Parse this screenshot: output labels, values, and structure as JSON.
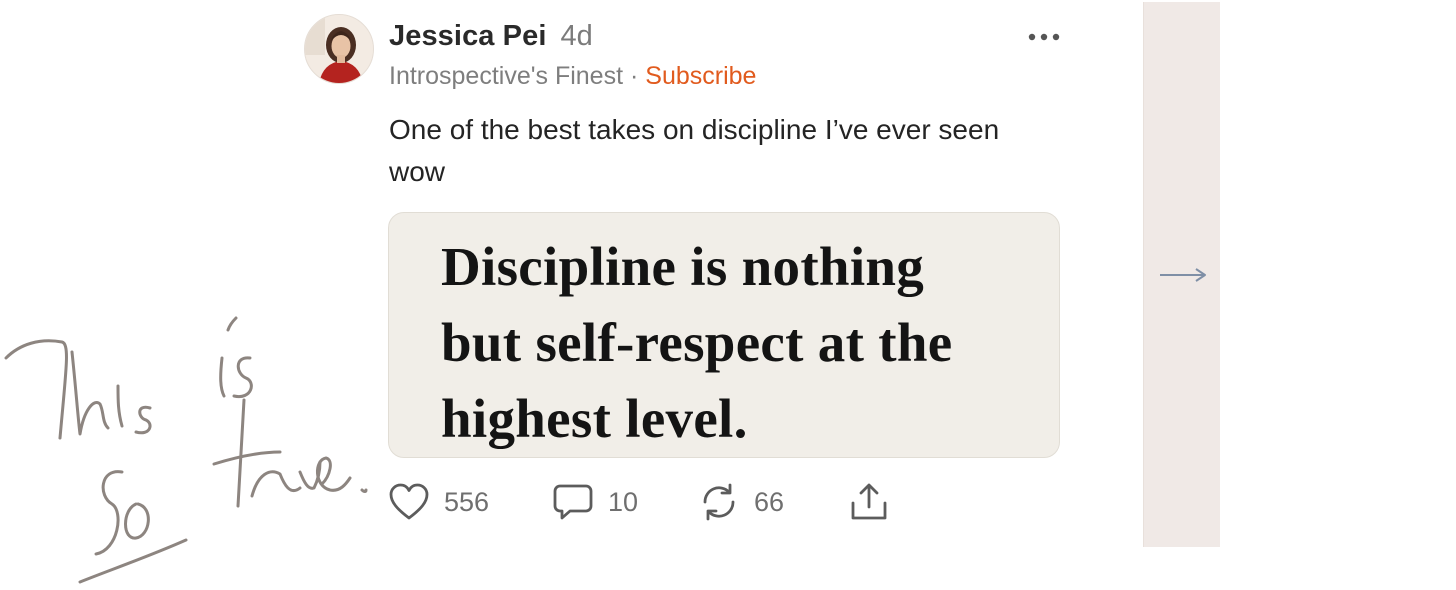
{
  "post": {
    "author": "Jessica Pei",
    "age": "4d",
    "publication": "Introspective's Finest",
    "separator": "·",
    "subscribe_label": "Subscribe",
    "body": "One of the best takes on discipline I’ve ever seen wow",
    "quote_lines": [
      "Discipline is nothing",
      "but self-respect at the",
      "highest level."
    ]
  },
  "actions": {
    "likes": "556",
    "comments": "10",
    "restacks": "66"
  },
  "icons": {
    "more": "more-dots-icon",
    "like": "heart-icon",
    "comment": "comment-icon",
    "restack": "restack-icon",
    "share": "share-icon",
    "next": "arrow-right-icon"
  },
  "handwriting": {
    "text": "This is so true."
  },
  "colors": {
    "accent": "#e15b1e",
    "muted_text": "#7e7e7e",
    "card_bg": "#f1eee8",
    "sidebar_bg": "#f0e9e6",
    "ink": "#8d8580"
  }
}
